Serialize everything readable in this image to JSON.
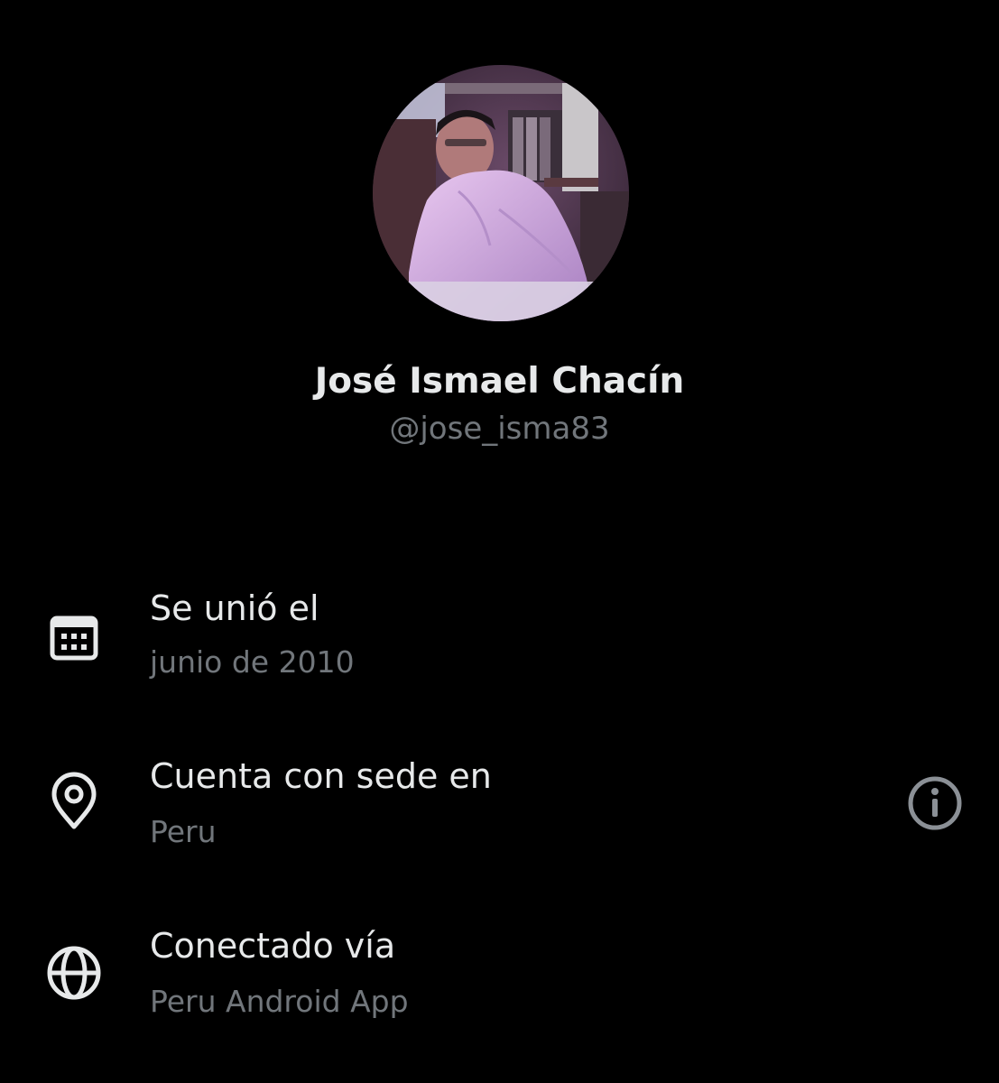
{
  "profile": {
    "display_name": "José Ismael Chacín",
    "handle": "@jose_isma83"
  },
  "details": {
    "joined": {
      "icon": "calendar-icon",
      "label": "Se unió el",
      "value": "junio de 2010"
    },
    "location": {
      "icon": "location-pin-icon",
      "label": "Cuenta con sede en",
      "value": "Peru",
      "action_icon": "info-icon"
    },
    "connected": {
      "icon": "globe-icon",
      "label": "Conectado vía",
      "value": "Peru Android App"
    }
  },
  "colors": {
    "background": "#000000",
    "primary_text": "#e7e9ea",
    "secondary_text": "#71767b",
    "icon": "#e7e9ea",
    "info_icon": "#71767b"
  }
}
